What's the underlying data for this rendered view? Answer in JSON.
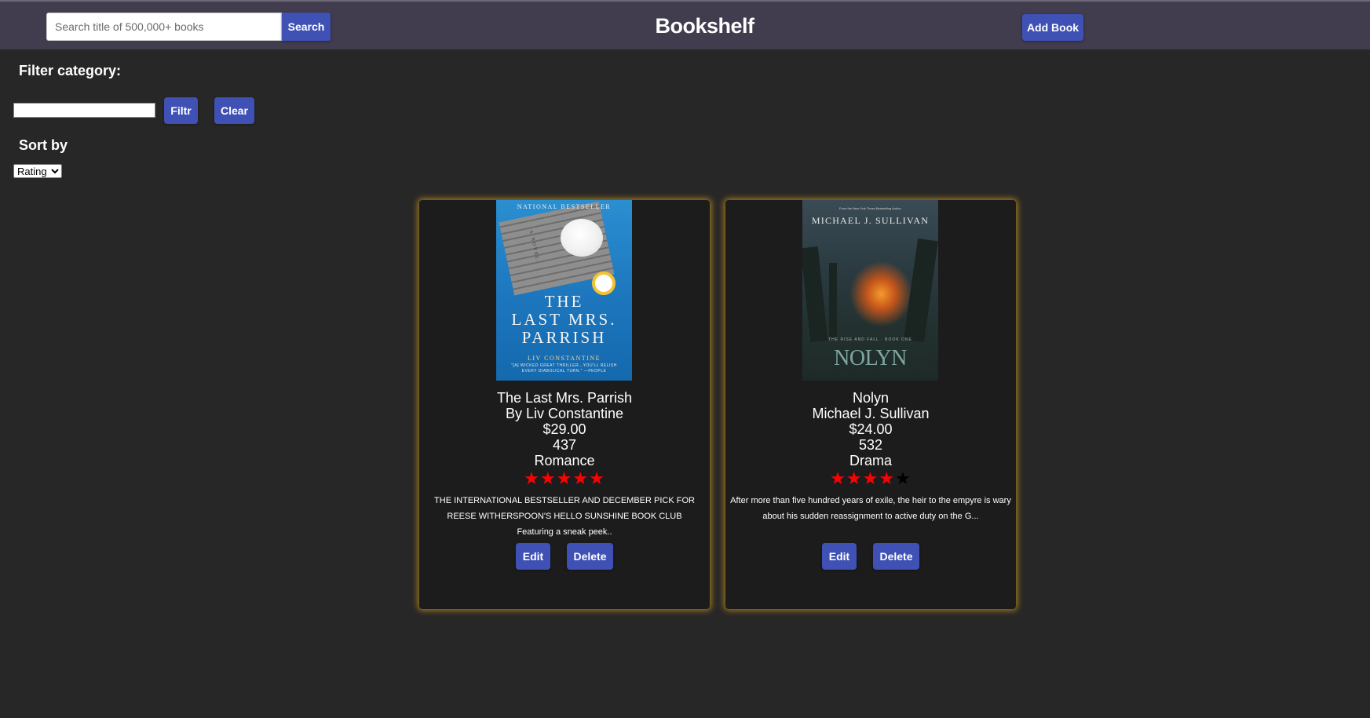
{
  "header": {
    "title": "Bookshelf",
    "search_placeholder": "Search title of 500,000+ books",
    "search_button": "Search",
    "add_book_button": "Add Book"
  },
  "filter": {
    "label": "Filter category:",
    "input_value": "",
    "filter_button": "Filtr",
    "clear_button": "Clear"
  },
  "sort": {
    "label": "Sort by",
    "selected": "Rating"
  },
  "books": [
    {
      "title": "The Last Mrs. Parrish",
      "author": "By Liv Constantine",
      "price": "$29.00",
      "pages": "437",
      "category": "Romance",
      "rating": 5,
      "description": "THE INTERNATIONAL BESTSELLER AND DECEMBER PICK FOR REESE WITHERSPOON'S HELLO SUNSHINE BOOK CLUB Featuring a sneak peek..",
      "edit_button": "Edit",
      "delete_button": "Delete",
      "cover": {
        "top_text": "NATIONAL BESTSELLER",
        "side_text": "A NOVEL",
        "title_line1": "THE",
        "title_line2": "LAST MRS.",
        "title_line3": "PARRISH",
        "author": "LIV CONSTANTINE",
        "quote_line1": "\"[A] WICKED GREAT THRILLER...YOU'LL RELISH",
        "quote_line2": "EVERY DIABOLICAL TURN.\" —PEOPLE"
      }
    },
    {
      "title": "Nolyn",
      "author": "Michael J. Sullivan",
      "price": "$24.00",
      "pages": "532",
      "category": "Drama",
      "rating": 4,
      "description": "After more than five hundred years of exile, the heir to the empyre is wary about his sudden reassignment to active duty on the G...",
      "edit_button": "Edit",
      "delete_button": "Delete",
      "cover": {
        "top_text": "From the New York Times Bestselling Author",
        "author": "MICHAEL J. SULLIVAN",
        "series": "THE RISE AND FALL · BOOK ONE",
        "title": "NOLYN"
      }
    }
  ],
  "colors": {
    "page_background": "#282727",
    "header_background": "#413c4e",
    "button": "#3f51b5",
    "card_background": "#1c1c1d",
    "card_glow": "#c8961e",
    "star_filled": "#ff0000",
    "star_empty": "#000000"
  }
}
